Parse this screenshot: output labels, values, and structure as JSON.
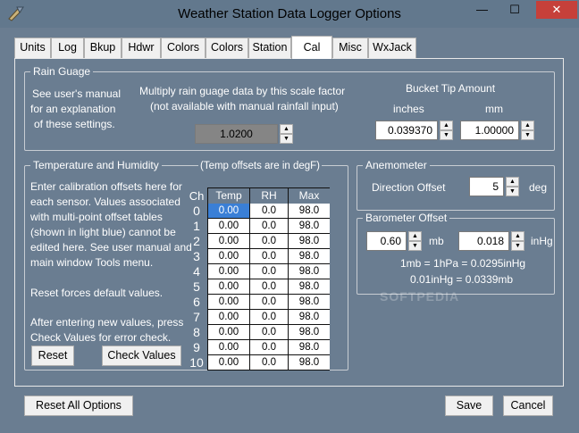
{
  "window": {
    "title": "Weather Station Data Logger Options",
    "minimize": "—",
    "maximize": "☐",
    "close": "✕"
  },
  "tabs": [
    "Units",
    "Log",
    "Bkup",
    "Hdwr",
    "Colors",
    "Colors",
    "Station",
    "Cal",
    "Misc",
    "WxJack"
  ],
  "active_tab": "Cal",
  "rain": {
    "title": "Rain Guage",
    "manual_note": [
      "See user's manual",
      "for an explanation",
      "of these settings."
    ],
    "scale_label_1": "Multiply rain guage data by this scale factor",
    "scale_label_2": "(not available with manual rainfall input)",
    "scale_value": "1.0200",
    "bucket_title": "Bucket Tip Amount",
    "inches_label": "inches",
    "mm_label": "mm",
    "inches_value": "0.039370",
    "mm_value": "1.00000"
  },
  "temp": {
    "title": "Temperature and Humidity",
    "offsets_note": "(Temp offsets are in degF)",
    "instructions": [
      "Enter calibration offsets here for",
      "each sensor. Values associated",
      "with multi-point offset tables",
      "(shown in light blue) cannot be",
      "edited here. See user manual and",
      "main window Tools menu."
    ],
    "reset_note": "Reset forces default values.",
    "check_note": [
      "After entering new values, press",
      "Check Values for error check."
    ],
    "ch_label": "Ch",
    "columns": [
      "Temp",
      "RH",
      "Max"
    ],
    "channels": [
      "0",
      "1",
      "2",
      "3",
      "4",
      "5",
      "6",
      "7",
      "8",
      "9",
      "10"
    ],
    "rows": [
      [
        "0.00",
        "0.0",
        "98.0"
      ],
      [
        "0.00",
        "0.0",
        "98.0"
      ],
      [
        "0.00",
        "0.0",
        "98.0"
      ],
      [
        "0.00",
        "0.0",
        "98.0"
      ],
      [
        "0.00",
        "0.0",
        "98.0"
      ],
      [
        "0.00",
        "0.0",
        "98.0"
      ],
      [
        "0.00",
        "0.0",
        "98.0"
      ],
      [
        "0.00",
        "0.0",
        "98.0"
      ],
      [
        "0.00",
        "0.0",
        "98.0"
      ],
      [
        "0.00",
        "0.0",
        "98.0"
      ],
      [
        "0.00",
        "0.0",
        "98.0"
      ]
    ],
    "reset_button": "Reset",
    "check_button": "Check Values"
  },
  "anemometer": {
    "title": "Anemometer",
    "direction_label": "Direction Offset",
    "direction_value": "5",
    "unit": "deg"
  },
  "barometer": {
    "title": "Barometer Offset",
    "mb_value": "0.60",
    "mb_unit": "mb",
    "inhg_value": "0.018",
    "inhg_unit": "inHg",
    "conv_1": "1mb = 1hPa = 0.0295inHg",
    "conv_2": "0.01inHg = 0.0339mb"
  },
  "watermark": "SOFTPEDIA",
  "footer": {
    "reset_all": "Reset All Options",
    "save": "Save",
    "cancel": "Cancel"
  }
}
